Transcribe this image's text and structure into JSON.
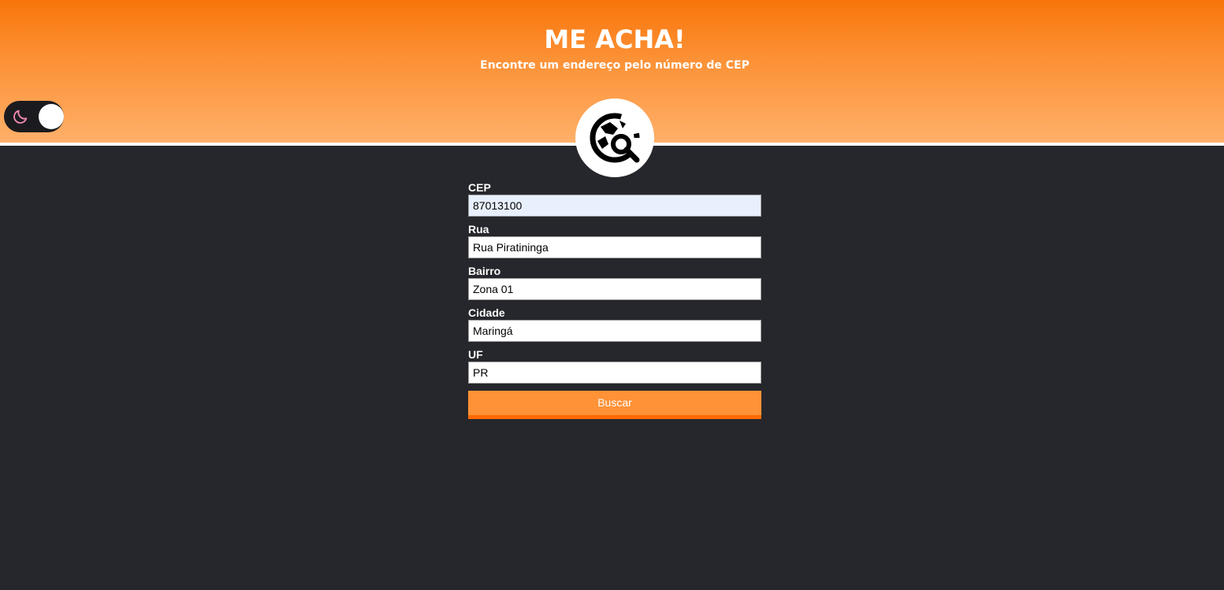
{
  "header": {
    "title": "ME ACHA!",
    "subtitle": "Encontre um endereço pelo número de CEP"
  },
  "theme_toggle": {
    "icon": "moon-icon",
    "state": "dark"
  },
  "logo": {
    "icon": "globe-search-icon"
  },
  "form": {
    "fields": [
      {
        "label": "CEP",
        "value": "87013100"
      },
      {
        "label": "Rua",
        "value": "Rua Piratininga"
      },
      {
        "label": "Bairro",
        "value": "Zona 01"
      },
      {
        "label": "Cidade",
        "value": "Maringá"
      },
      {
        "label": "UF",
        "value": "PR"
      }
    ],
    "submit_label": "Buscar"
  },
  "colors": {
    "header_top": "#f8750a",
    "header_bottom": "#ffb06a",
    "background": "#26272c",
    "button": "#ff9236",
    "button_border": "#ff6a00",
    "moon": "#f28ab2"
  }
}
